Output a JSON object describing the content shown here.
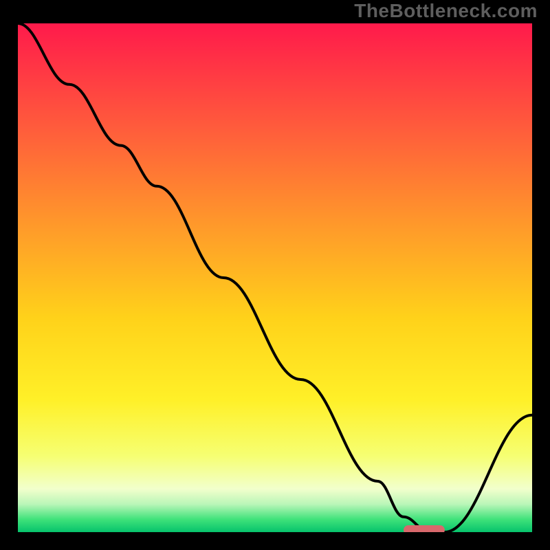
{
  "watermark": "TheBottleneck.com",
  "colors": {
    "frame": "#000000",
    "curve": "#000000",
    "marker": "#d9686c",
    "gradient_stops": [
      {
        "offset": 0.0,
        "color": "#ff1a4b"
      },
      {
        "offset": 0.2,
        "color": "#ff5a3c"
      },
      {
        "offset": 0.4,
        "color": "#ff9a2a"
      },
      {
        "offset": 0.58,
        "color": "#ffd21a"
      },
      {
        "offset": 0.74,
        "color": "#fff028"
      },
      {
        "offset": 0.85,
        "color": "#f6ff72"
      },
      {
        "offset": 0.915,
        "color": "#f2ffcc"
      },
      {
        "offset": 0.945,
        "color": "#baf6b8"
      },
      {
        "offset": 0.975,
        "color": "#3fe27a"
      },
      {
        "offset": 1.0,
        "color": "#06c36c"
      }
    ]
  },
  "chart_data": {
    "type": "line",
    "title": "",
    "xlabel": "",
    "ylabel": "",
    "xlim": [
      0,
      100
    ],
    "ylim": [
      0,
      100
    ],
    "series": [
      {
        "name": "bottleneck-curve",
        "x": [
          0,
          10,
          20,
          27,
          40,
          55,
          70,
          75,
          80,
          83,
          100
        ],
        "y": [
          100,
          88,
          76,
          68,
          50,
          30,
          10,
          3,
          0,
          0,
          23
        ]
      }
    ],
    "marker": {
      "x_start": 75,
      "x_end": 83,
      "y": 0
    },
    "grid": false,
    "legend": false
  }
}
